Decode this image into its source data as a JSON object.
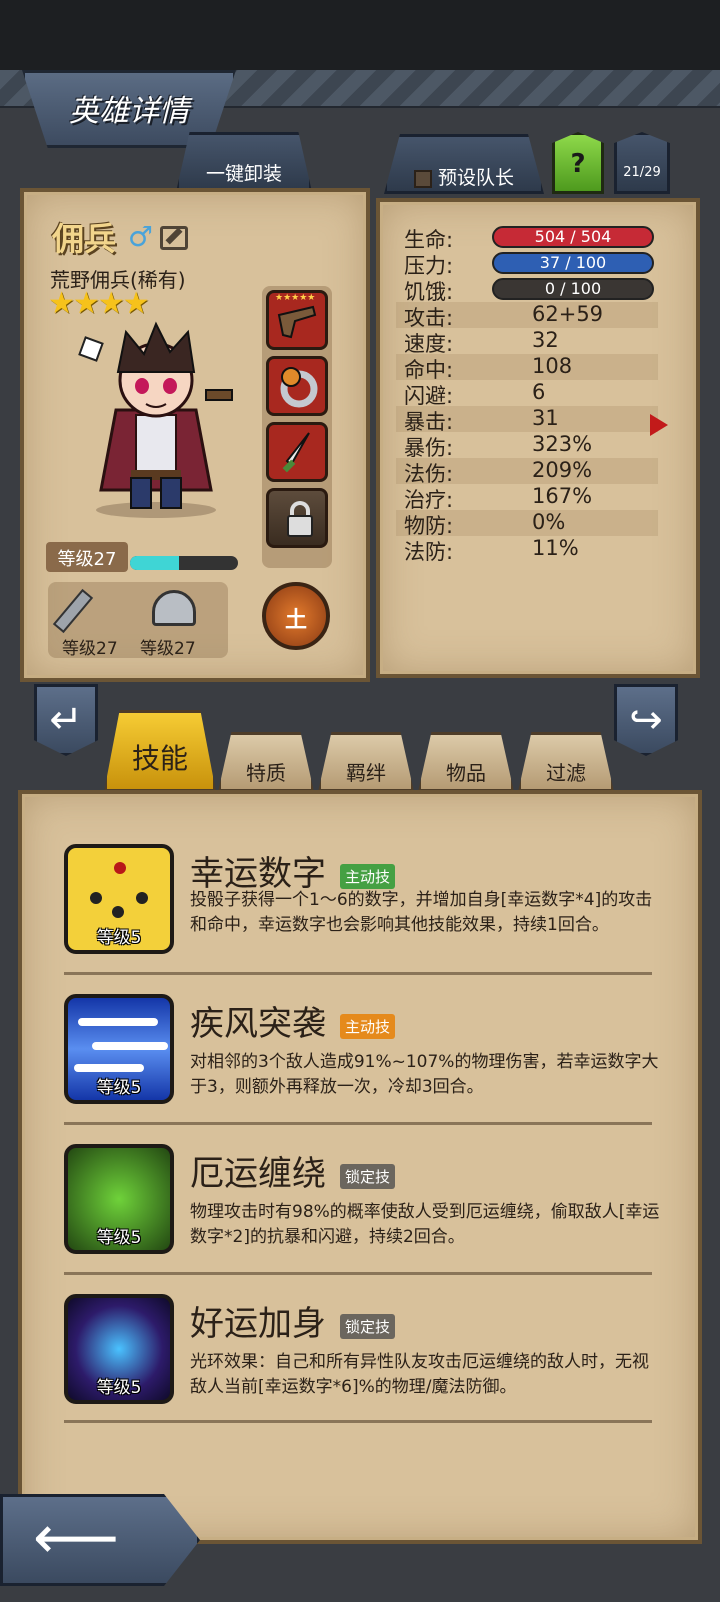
{
  "header": {
    "title": "英雄详情",
    "unequip_label": "一键卸装",
    "captain_label": "预设队长",
    "help_label": "?",
    "hero_count": "21/29"
  },
  "hero": {
    "name": "佣兵",
    "gender_icon": "male-icon",
    "class_label": "荒野佣兵(稀有)",
    "stars": "★★★★",
    "star_count": 4,
    "level_label": "等级27",
    "xp_fraction": 0.45,
    "weapon_level": "等级27",
    "armor_level": "等级27",
    "element": "土"
  },
  "equipment": {
    "slots": [
      {
        "name": "pistol-item",
        "stars": "★★★★★"
      },
      {
        "name": "ring-item",
        "stars": ""
      },
      {
        "name": "dagger-item",
        "stars": ""
      },
      {
        "name": "locked-slot",
        "stars": ""
      }
    ]
  },
  "stats": {
    "hp_label": "生命:",
    "hp_value": "504 / 504",
    "stress_label": "压力:",
    "stress_value": "37 / 100",
    "hunger_label": "饥饿:",
    "hunger_value": "0 / 100",
    "attack_label": "攻击:",
    "attack_value": "62+59",
    "speed_label": "速度:",
    "speed_value": "32",
    "accuracy_label": "命中:",
    "accuracy_value": "108",
    "dodge_label": "闪避:",
    "dodge_value": "6",
    "crit_label": "暴击:",
    "crit_value": "31",
    "crit_dmg_label": "暴伤:",
    "crit_dmg_value": "323%",
    "magic_dmg_label": "法伤:",
    "magic_dmg_value": "209%",
    "heal_label": "治疗:",
    "heal_value": "167%",
    "phys_def_label": "物防:",
    "phys_def_value": "0%",
    "magic_def_label": "法防:",
    "magic_def_value": "11%"
  },
  "tabs": {
    "skills": "技能",
    "traits": "特质",
    "bonds": "羁绊",
    "items": "物品",
    "filter": "过滤"
  },
  "skills": [
    {
      "name": "幸运数字",
      "tag": "主动技",
      "level": "等级5",
      "desc": "投骰子获得一个1～6的数字，并增加自身[幸运数字*4]的攻击和命中，幸运数字也会影响其他技能效果，持续1回合。"
    },
    {
      "name": "疾风突袭",
      "tag": "主动技",
      "level": "等级5",
      "desc": "对相邻的3个敌人造成91%~107%的物理伤害，若幸运数字大于3，则额外再释放一次，冷却3回合。"
    },
    {
      "name": "厄运缠绕",
      "tag": "锁定技",
      "level": "等级5",
      "desc": "物理攻击时有98%的概率使敌人受到厄运缠绕，偷取敌人[幸运数字*2]的抗暴和闪避，持续2回合。"
    },
    {
      "name": "好运加身",
      "tag": "锁定技",
      "level": "等级5",
      "desc": "光环效果：自己和所有异性队友攻击厄运缠绕的敌人时，无视敌人当前[幸运数字*6]%的物理/魔法防御。"
    }
  ],
  "colors": {
    "active_tag": "#45a043",
    "active_tag_alt": "#e58a1c",
    "locked_tag": "#6b665e",
    "hp_bar": "#c62a36",
    "stress_bar": "#2e5fb3"
  }
}
